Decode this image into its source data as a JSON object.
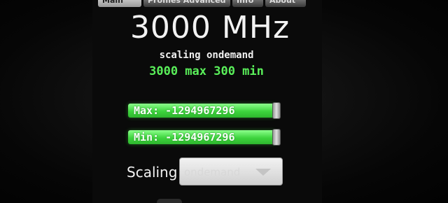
{
  "tabs": [
    {
      "label": "Main",
      "selected": true
    },
    {
      "label": "Profiles  Advanced",
      "selected": false
    },
    {
      "label": "Info",
      "selected": false
    },
    {
      "label": "About",
      "selected": false
    }
  ],
  "frequency": "3000 MHz",
  "scaling_line": "scaling ondemand",
  "maxmin_line": "3000 max 300 min",
  "sliders": {
    "max": {
      "label": "Max: -1294967296",
      "level": 1.0
    },
    "min": {
      "label": "Min: -1294967296",
      "level": 1.0
    }
  },
  "scaling": {
    "label": "Scaling",
    "selected": "ondemand"
  },
  "colors": {
    "accent_green": "#5af05a",
    "slider_green": "#3ed43e",
    "background": "#050505"
  }
}
